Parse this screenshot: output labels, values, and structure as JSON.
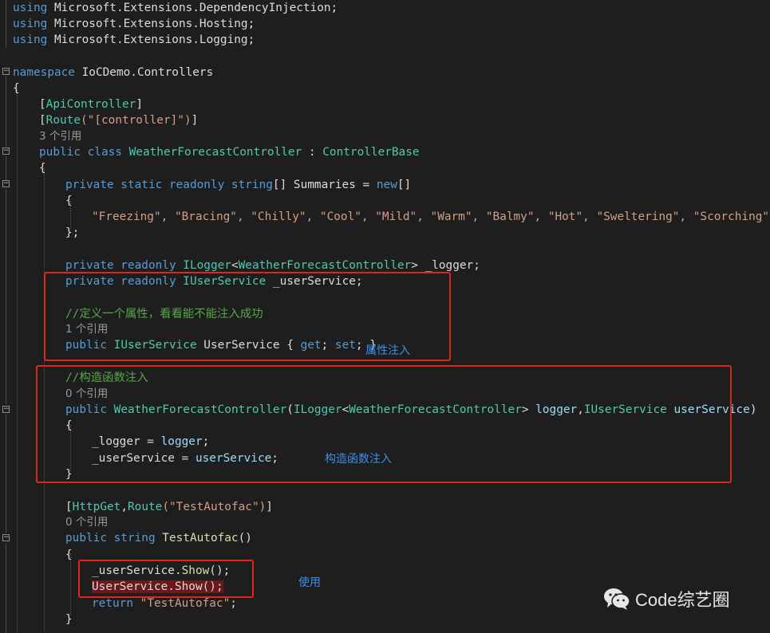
{
  "code": {
    "using1": "using",
    "using1_ns": " Microsoft.Extensions.DependencyInjection;",
    "using2": "using",
    "using2_ns": " Microsoft.Extensions.Hosting;",
    "using3": "using",
    "using3_ns": " Microsoft.Extensions.Logging;",
    "namespace_kw": "namespace",
    "namespace_name": " IoCDemo.Controllers",
    "brace_open": "{",
    "brace_close": "}",
    "attr_api_open": "[",
    "attr_api": "ApiController",
    "attr_api_close": "]",
    "attr_route_open": "[",
    "attr_route": "Route",
    "attr_route_args": "(\"[controller]\")",
    "attr_route_close": "]",
    "refs_class": "3 个引用",
    "class_decl_kw": "public class ",
    "class_name": "WeatherForecastController",
    "class_colon": " : ",
    "class_base": "ControllerBase",
    "summ_kw": "private static readonly string",
    "summ_rest": "[] Summaries = ",
    "summ_new": "new",
    "summ_brackets": "[]",
    "summ_values": "\"Freezing\", \"Bracing\", \"Chilly\", \"Cool\", \"Mild\", \"Warm\", \"Balmy\", \"Hot\", \"Sweltering\", \"Scorching\"",
    "summ_end": "};",
    "logger_kw": "private readonly ",
    "logger_type": "ILogger",
    "logger_lt": "<",
    "logger_generic": "WeatherForecastController",
    "logger_gt": "> ",
    "logger_name": "_logger;",
    "svc_kw": "private readonly ",
    "svc_type": "IUserService",
    "svc_name": " _userService;",
    "comment_prop": "//定义一个属性，看看能不能注入成功",
    "refs_prop": "1 个引用",
    "prop_kw": "public ",
    "prop_type": "IUserService",
    "prop_name": " UserService { ",
    "prop_get": "get",
    "prop_sep": "; ",
    "prop_set": "set",
    "prop_end": "; }",
    "comment_ctor": "//构造函数注入",
    "refs_ctor": "0 个引用",
    "ctor_kw": "public ",
    "ctor_name": "WeatherForecastController",
    "ctor_p1": "(",
    "ctor_logger_type": "ILogger",
    "ctor_lt": "<",
    "ctor_generic": "WeatherForecastController",
    "ctor_gt": "> ",
    "ctor_logger": "logger",
    "ctor_comma": ",",
    "ctor_svc_type": "IUserService",
    "ctor_space": " ",
    "ctor_svc": "userService",
    "ctor_p2": ")",
    "assign1_lhs": "_logger = ",
    "assign1_rhs": "logger",
    "assign1_end": ";",
    "assign2_lhs": "_userService = ",
    "assign2_rhs": "userService",
    "assign2_end": ";",
    "attr_http_open": "[",
    "attr_http": "HttpGet",
    "attr_http_comma": ",",
    "attr_route2": "Route",
    "attr_route2_args": "(\"TestAutofac\")",
    "attr_http_close": "]",
    "refs_method": "0 个引用",
    "method_kw": "public string ",
    "method_name": "TestAutofac",
    "method_parens": "()",
    "call1_obj": "_userService.",
    "call1_fn": "Show",
    "call1_end": "();",
    "call2": "UserService.Show();",
    "return_kw": "return ",
    "return_val": "\"TestAutofac\"",
    "return_end": ";"
  },
  "annotations": {
    "property_injection": "属性注入",
    "constructor_injection": "构造函数注入",
    "usage": "使用"
  },
  "watermark": {
    "text": "Code综艺圈"
  },
  "colors": {
    "background": "#1e1e1e",
    "keyword": "#569cd6",
    "type": "#4ec9b0",
    "string": "#d69d85",
    "comment": "#57a64a",
    "annotation": "#3b8eea",
    "highlight_box": "#e0261b"
  }
}
